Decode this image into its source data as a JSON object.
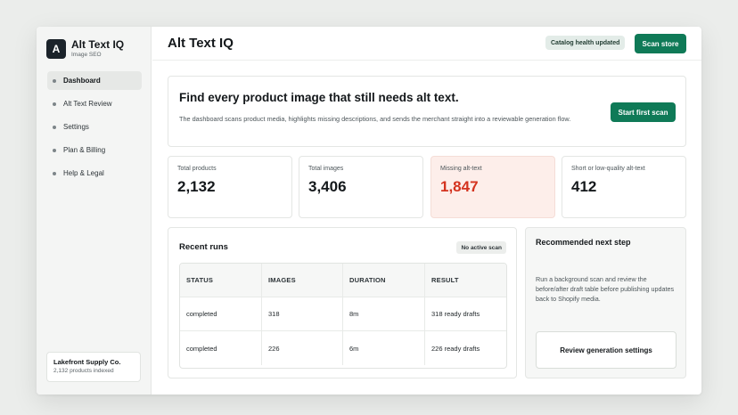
{
  "app": {
    "name": "Alt Text IQ",
    "subtitle": "Image SEO",
    "logo_letter": "A"
  },
  "sidebar": {
    "items": [
      {
        "label": "Dashboard",
        "active": true
      },
      {
        "label": "Alt Text Review",
        "active": false
      },
      {
        "label": "Settings",
        "active": false
      },
      {
        "label": "Plan & Billing",
        "active": false
      },
      {
        "label": "Help & Legal",
        "active": false
      }
    ],
    "store": {
      "name": "Lakefront Supply Co.",
      "detail": "2,132 products indexed"
    }
  },
  "header": {
    "title": "Alt Text IQ",
    "badge": "Catalog health updated",
    "scan_button": "Scan store"
  },
  "hero": {
    "title": "Find every product image that still needs alt text.",
    "description": "The dashboard scans product media, highlights missing descriptions, and sends the merchant straight into a reviewable generation flow.",
    "button": "Start first scan"
  },
  "stats": [
    {
      "label": "Total products",
      "value": "2,132"
    },
    {
      "label": "Total images",
      "value": "3,406"
    },
    {
      "label": "Missing alt-text",
      "value": "1,847"
    },
    {
      "label": "Short or low-quality alt-text",
      "value": "412"
    }
  ],
  "runs": {
    "title": "Recent runs",
    "badge": "No active scan",
    "columns": [
      "STATUS",
      "IMAGES",
      "DURATION",
      "RESULT"
    ],
    "rows": [
      [
        "completed",
        "318",
        "8m",
        "318 ready drafts"
      ],
      [
        "completed",
        "226",
        "6m",
        "226 ready drafts"
      ]
    ]
  },
  "next_step": {
    "title": "Recommended next step",
    "description": "Run a background scan and review the before/after draft table before publishing updates back to Shopify media.",
    "button": "Review generation settings"
  },
  "colors": {
    "accent": "#0f7a57",
    "alert_text": "#d4331f",
    "alert_bg": "#fdeeea"
  }
}
